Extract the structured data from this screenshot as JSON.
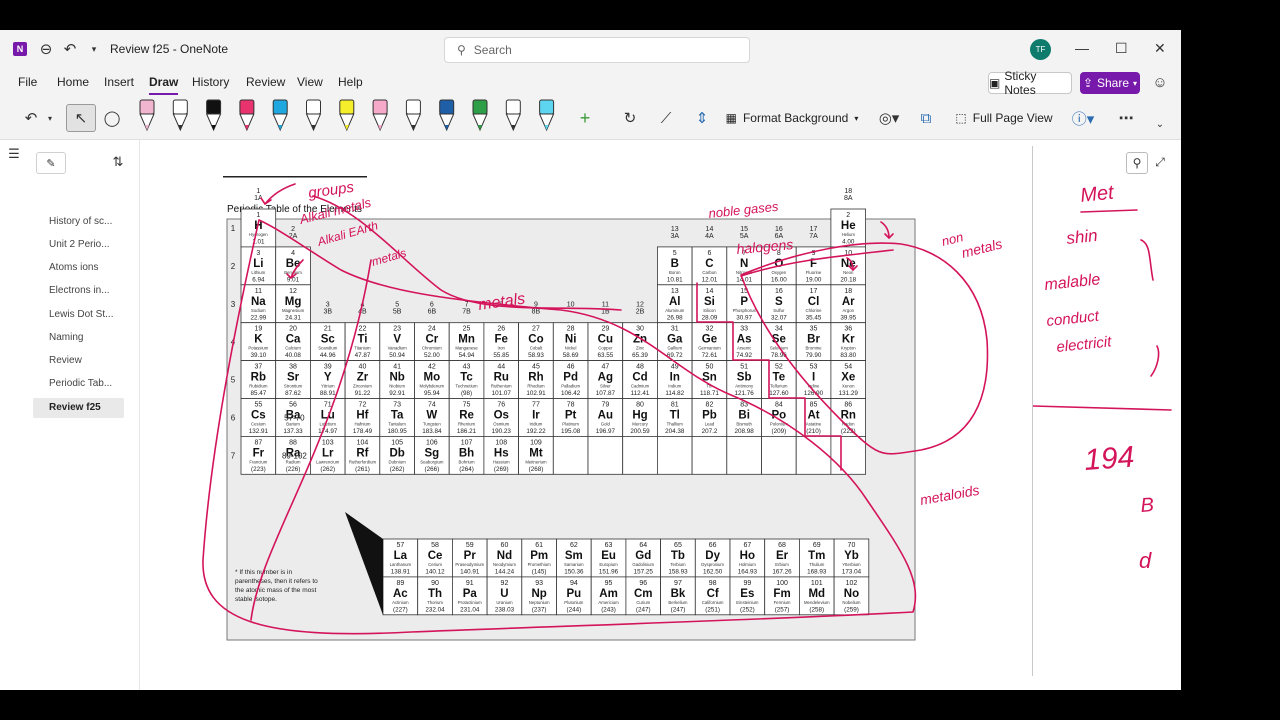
{
  "window": {
    "title": "Review f25 - OneNote",
    "app_icon_letter": "N"
  },
  "titlebar": {
    "search_placeholder": "Search",
    "avatar_initials": "TF"
  },
  "menu": [
    "File",
    "Home",
    "Insert",
    "Draw",
    "History",
    "Review",
    "View",
    "Help"
  ],
  "menu_active": "Draw",
  "toolbar": {
    "sticky_notes": "Sticky Notes",
    "share": "Share",
    "format_background": "Format Background",
    "full_page_view": "Full Page View"
  },
  "sidebar": {
    "pages": [
      "History of sc...",
      "Unit 2 Perio...",
      "Atoms ions",
      "Electrons in...",
      "Lewis Dot St...",
      "Naming",
      "Review",
      "Periodic Tab...",
      "Review f25"
    ],
    "selected": "Review f25"
  },
  "colors": {
    "accent": "#7719aa",
    "ink": "#d4145a",
    "titlebar": "#f3f3f3"
  },
  "periodic_table": {
    "title": "Periodic Table of the Elements",
    "footnote": "* If this number is in parentheses, then it refers to the atomic mass of the most stable isotope.",
    "lanthanide_range": "57-70",
    "actinide_range": "89-102",
    "group_labels": [
      {
        "g": 1,
        "n": "1",
        "s": "1A"
      },
      {
        "g": 2,
        "n": "2",
        "s": "2A"
      },
      {
        "g": 3,
        "n": "3",
        "s": "3B"
      },
      {
        "g": 4,
        "n": "4",
        "s": "4B"
      },
      {
        "g": 5,
        "n": "5",
        "s": "5B"
      },
      {
        "g": 6,
        "n": "6",
        "s": "6B"
      },
      {
        "g": 7,
        "n": "7",
        "s": "7B"
      },
      {
        "g": 8,
        "n": "8",
        "s": ""
      },
      {
        "g": 9,
        "n": "9",
        "s": "8B"
      },
      {
        "g": 10,
        "n": "10",
        "s": ""
      },
      {
        "g": 11,
        "n": "11",
        "s": "1B"
      },
      {
        "g": 12,
        "n": "12",
        "s": "2B"
      },
      {
        "g": 13,
        "n": "13",
        "s": "3A"
      },
      {
        "g": 14,
        "n": "14",
        "s": "4A"
      },
      {
        "g": 15,
        "n": "15",
        "s": "5A"
      },
      {
        "g": 16,
        "n": "16",
        "s": "6A"
      },
      {
        "g": 17,
        "n": "17",
        "s": "7A"
      },
      {
        "g": 18,
        "n": "18",
        "s": "8A"
      }
    ],
    "elements": [
      {
        "n": 1,
        "s": "H",
        "name": "Hydrogen",
        "m": "1.01",
        "p": 1,
        "g": 1
      },
      {
        "n": 2,
        "s": "He",
        "name": "Helium",
        "m": "4.00",
        "p": 1,
        "g": 18
      },
      {
        "n": 3,
        "s": "Li",
        "name": "Lithium",
        "m": "6.94",
        "p": 2,
        "g": 1
      },
      {
        "n": 4,
        "s": "Be",
        "name": "Beryllium",
        "m": "9.01",
        "p": 2,
        "g": 2
      },
      {
        "n": 5,
        "s": "B",
        "name": "Boron",
        "m": "10.81",
        "p": 2,
        "g": 13
      },
      {
        "n": 6,
        "s": "C",
        "name": "Carbon",
        "m": "12.01",
        "p": 2,
        "g": 14
      },
      {
        "n": 7,
        "s": "N",
        "name": "Nitrogen",
        "m": "14.01",
        "p": 2,
        "g": 15
      },
      {
        "n": 8,
        "s": "O",
        "name": "Oxygen",
        "m": "16.00",
        "p": 2,
        "g": 16
      },
      {
        "n": 9,
        "s": "F",
        "name": "Fluorine",
        "m": "19.00",
        "p": 2,
        "g": 17
      },
      {
        "n": 10,
        "s": "Ne",
        "name": "Neon",
        "m": "20.18",
        "p": 2,
        "g": 18
      },
      {
        "n": 11,
        "s": "Na",
        "name": "Sodium",
        "m": "22.99",
        "p": 3,
        "g": 1
      },
      {
        "n": 12,
        "s": "Mg",
        "name": "Magnesium",
        "m": "24.31",
        "p": 3,
        "g": 2
      },
      {
        "n": 13,
        "s": "Al",
        "name": "Aluminum",
        "m": "26.98",
        "p": 3,
        "g": 13
      },
      {
        "n": 14,
        "s": "Si",
        "name": "Silicon",
        "m": "28.09",
        "p": 3,
        "g": 14
      },
      {
        "n": 15,
        "s": "P",
        "name": "Phosphorus",
        "m": "30.97",
        "p": 3,
        "g": 15
      },
      {
        "n": 16,
        "s": "S",
        "name": "Sulfur",
        "m": "32.07",
        "p": 3,
        "g": 16
      },
      {
        "n": 17,
        "s": "Cl",
        "name": "Chlorine",
        "m": "35.45",
        "p": 3,
        "g": 17
      },
      {
        "n": 18,
        "s": "Ar",
        "name": "Argon",
        "m": "39.95",
        "p": 3,
        "g": 18
      },
      {
        "n": 19,
        "s": "K",
        "name": "Potassium",
        "m": "39.10",
        "p": 4,
        "g": 1
      },
      {
        "n": 20,
        "s": "Ca",
        "name": "Calcium",
        "m": "40.08",
        "p": 4,
        "g": 2
      },
      {
        "n": 21,
        "s": "Sc",
        "name": "Scandium",
        "m": "44.96",
        "p": 4,
        "g": 3
      },
      {
        "n": 22,
        "s": "Ti",
        "name": "Titanium",
        "m": "47.87",
        "p": 4,
        "g": 4
      },
      {
        "n": 23,
        "s": "V",
        "name": "Vanadium",
        "m": "50.94",
        "p": 4,
        "g": 5
      },
      {
        "n": 24,
        "s": "Cr",
        "name": "Chromium",
        "m": "52.00",
        "p": 4,
        "g": 6
      },
      {
        "n": 25,
        "s": "Mn",
        "name": "Manganese",
        "m": "54.94",
        "p": 4,
        "g": 7
      },
      {
        "n": 26,
        "s": "Fe",
        "name": "Iron",
        "m": "55.85",
        "p": 4,
        "g": 8
      },
      {
        "n": 27,
        "s": "Co",
        "name": "Cobalt",
        "m": "58.93",
        "p": 4,
        "g": 9
      },
      {
        "n": 28,
        "s": "Ni",
        "name": "Nickel",
        "m": "58.69",
        "p": 4,
        "g": 10
      },
      {
        "n": 29,
        "s": "Cu",
        "name": "Copper",
        "m": "63.55",
        "p": 4,
        "g": 11
      },
      {
        "n": 30,
        "s": "Zn",
        "name": "Zinc",
        "m": "65.39",
        "p": 4,
        "g": 12
      },
      {
        "n": 31,
        "s": "Ga",
        "name": "Gallium",
        "m": "69.72",
        "p": 4,
        "g": 13
      },
      {
        "n": 32,
        "s": "Ge",
        "name": "Germanium",
        "m": "72.61",
        "p": 4,
        "g": 14
      },
      {
        "n": 33,
        "s": "As",
        "name": "Arsenic",
        "m": "74.92",
        "p": 4,
        "g": 15
      },
      {
        "n": 34,
        "s": "Se",
        "name": "Selenium",
        "m": "78.96",
        "p": 4,
        "g": 16
      },
      {
        "n": 35,
        "s": "Br",
        "name": "Bromine",
        "m": "79.90",
        "p": 4,
        "g": 17
      },
      {
        "n": 36,
        "s": "Kr",
        "name": "Krypton",
        "m": "83.80",
        "p": 4,
        "g": 18
      },
      {
        "n": 37,
        "s": "Rb",
        "name": "Rubidium",
        "m": "85.47",
        "p": 5,
        "g": 1
      },
      {
        "n": 38,
        "s": "Sr",
        "name": "Strontium",
        "m": "87.62",
        "p": 5,
        "g": 2
      },
      {
        "n": 39,
        "s": "Y",
        "name": "Yttrium",
        "m": "88.91",
        "p": 5,
        "g": 3
      },
      {
        "n": 40,
        "s": "Zr",
        "name": "Zirconium",
        "m": "91.22",
        "p": 5,
        "g": 4
      },
      {
        "n": 41,
        "s": "Nb",
        "name": "Niobium",
        "m": "92.91",
        "p": 5,
        "g": 5
      },
      {
        "n": 42,
        "s": "Mo",
        "name": "Molybdenum",
        "m": "95.94",
        "p": 5,
        "g": 6
      },
      {
        "n": 43,
        "s": "Tc",
        "name": "Technetium",
        "m": "(98)",
        "p": 5,
        "g": 7
      },
      {
        "n": 44,
        "s": "Ru",
        "name": "Ruthenium",
        "m": "101.07",
        "p": 5,
        "g": 8
      },
      {
        "n": 45,
        "s": "Rh",
        "name": "Rhodium",
        "m": "102.91",
        "p": 5,
        "g": 9
      },
      {
        "n": 46,
        "s": "Pd",
        "name": "Palladium",
        "m": "106.42",
        "p": 5,
        "g": 10
      },
      {
        "n": 47,
        "s": "Ag",
        "name": "Silver",
        "m": "107.87",
        "p": 5,
        "g": 11
      },
      {
        "n": 48,
        "s": "Cd",
        "name": "Cadmium",
        "m": "112.41",
        "p": 5,
        "g": 12
      },
      {
        "n": 49,
        "s": "In",
        "name": "Indium",
        "m": "114.82",
        "p": 5,
        "g": 13
      },
      {
        "n": 50,
        "s": "Sn",
        "name": "Tin",
        "m": "118.71",
        "p": 5,
        "g": 14
      },
      {
        "n": 51,
        "s": "Sb",
        "name": "Antimony",
        "m": "121.76",
        "p": 5,
        "g": 15
      },
      {
        "n": 52,
        "s": "Te",
        "name": "Tellurium",
        "m": "127.60",
        "p": 5,
        "g": 16
      },
      {
        "n": 53,
        "s": "I",
        "name": "Iodine",
        "m": "126.90",
        "p": 5,
        "g": 17
      },
      {
        "n": 54,
        "s": "Xe",
        "name": "Xenon",
        "m": "131.29",
        "p": 5,
        "g": 18
      },
      {
        "n": 55,
        "s": "Cs",
        "name": "Cesium",
        "m": "132.91",
        "p": 6,
        "g": 1
      },
      {
        "n": 56,
        "s": "Ba",
        "name": "Barium",
        "m": "137.33",
        "p": 6,
        "g": 2
      },
      {
        "n": 71,
        "s": "Lu",
        "name": "Lutetium",
        "m": "174.97",
        "p": 6,
        "g": 3
      },
      {
        "n": 72,
        "s": "Hf",
        "name": "Hafnium",
        "m": "178.49",
        "p": 6,
        "g": 4
      },
      {
        "n": 73,
        "s": "Ta",
        "name": "Tantalum",
        "m": "180.95",
        "p": 6,
        "g": 5
      },
      {
        "n": 74,
        "s": "W",
        "name": "Tungsten",
        "m": "183.84",
        "p": 6,
        "g": 6
      },
      {
        "n": 75,
        "s": "Re",
        "name": "Rhenium",
        "m": "186.21",
        "p": 6,
        "g": 7
      },
      {
        "n": 76,
        "s": "Os",
        "name": "Osmium",
        "m": "190.23",
        "p": 6,
        "g": 8
      },
      {
        "n": 77,
        "s": "Ir",
        "name": "Iridium",
        "m": "192.22",
        "p": 6,
        "g": 9
      },
      {
        "n": 78,
        "s": "Pt",
        "name": "Platinum",
        "m": "195.08",
        "p": 6,
        "g": 10
      },
      {
        "n": 79,
        "s": "Au",
        "name": "Gold",
        "m": "196.97",
        "p": 6,
        "g": 11
      },
      {
        "n": 80,
        "s": "Hg",
        "name": "Mercury",
        "m": "200.59",
        "p": 6,
        "g": 12
      },
      {
        "n": 81,
        "s": "Tl",
        "name": "Thallium",
        "m": "204.38",
        "p": 6,
        "g": 13
      },
      {
        "n": 82,
        "s": "Pb",
        "name": "Lead",
        "m": "207.2",
        "p": 6,
        "g": 14
      },
      {
        "n": 83,
        "s": "Bi",
        "name": "Bismuth",
        "m": "208.98",
        "p": 6,
        "g": 15
      },
      {
        "n": 84,
        "s": "Po",
        "name": "Polonium",
        "m": "(209)",
        "p": 6,
        "g": 16
      },
      {
        "n": 85,
        "s": "At",
        "name": "Astatine",
        "m": "(210)",
        "p": 6,
        "g": 17
      },
      {
        "n": 86,
        "s": "Rn",
        "name": "Radon",
        "m": "(222)",
        "p": 6,
        "g": 18
      },
      {
        "n": 87,
        "s": "Fr",
        "name": "Francium",
        "m": "(223)",
        "p": 7,
        "g": 1
      },
      {
        "n": 88,
        "s": "Ra",
        "name": "Radium",
        "m": "(226)",
        "p": 7,
        "g": 2
      },
      {
        "n": 103,
        "s": "Lr",
        "name": "Lawrencium",
        "m": "(262)",
        "p": 7,
        "g": 3
      },
      {
        "n": 104,
        "s": "Rf",
        "name": "Rutherfordium",
        "m": "(261)",
        "p": 7,
        "g": 4
      },
      {
        "n": 105,
        "s": "Db",
        "name": "Dubnium",
        "m": "(262)",
        "p": 7,
        "g": 5
      },
      {
        "n": 106,
        "s": "Sg",
        "name": "Seaborgium",
        "m": "(266)",
        "p": 7,
        "g": 6
      },
      {
        "n": 107,
        "s": "Bh",
        "name": "Bohrium",
        "m": "(264)",
        "p": 7,
        "g": 7
      },
      {
        "n": 108,
        "s": "Hs",
        "name": "Hassium",
        "m": "(269)",
        "p": 7,
        "g": 8
      },
      {
        "n": 109,
        "s": "Mt",
        "name": "Meitnerium",
        "m": "(268)",
        "p": 7,
        "g": 9
      }
    ],
    "lanthanides": [
      {
        "n": 57,
        "s": "La",
        "name": "Lanthanum",
        "m": "138.91"
      },
      {
        "n": 58,
        "s": "Ce",
        "name": "Cerium",
        "m": "140.12"
      },
      {
        "n": 59,
        "s": "Pr",
        "name": "Praseodymium",
        "m": "140.91"
      },
      {
        "n": 60,
        "s": "Nd",
        "name": "Neodymium",
        "m": "144.24"
      },
      {
        "n": 61,
        "s": "Pm",
        "name": "Promethium",
        "m": "(145)"
      },
      {
        "n": 62,
        "s": "Sm",
        "name": "Samarium",
        "m": "150.36"
      },
      {
        "n": 63,
        "s": "Eu",
        "name": "Europium",
        "m": "151.96"
      },
      {
        "n": 64,
        "s": "Gd",
        "name": "Gadolinium",
        "m": "157.25"
      },
      {
        "n": 65,
        "s": "Tb",
        "name": "Terbium",
        "m": "158.93"
      },
      {
        "n": 66,
        "s": "Dy",
        "name": "Dysprosium",
        "m": "162.50"
      },
      {
        "n": 67,
        "s": "Ho",
        "name": "Holmium",
        "m": "164.93"
      },
      {
        "n": 68,
        "s": "Er",
        "name": "Erbium",
        "m": "167.26"
      },
      {
        "n": 69,
        "s": "Tm",
        "name": "Thulium",
        "m": "168.93"
      },
      {
        "n": 70,
        "s": "Yb",
        "name": "Ytterbium",
        "m": "173.04"
      }
    ],
    "actinides": [
      {
        "n": 89,
        "s": "Ac",
        "name": "Actinium",
        "m": "(227)"
      },
      {
        "n": 90,
        "s": "Th",
        "name": "Thorium",
        "m": "232.04"
      },
      {
        "n": 91,
        "s": "Pa",
        "name": "Protactinium",
        "m": "231.04"
      },
      {
        "n": 92,
        "s": "U",
        "name": "Uranium",
        "m": "238.03"
      },
      {
        "n": 93,
        "s": "Np",
        "name": "Neptunium",
        "m": "(237)"
      },
      {
        "n": 94,
        "s": "Pu",
        "name": "Plutonium",
        "m": "(244)"
      },
      {
        "n": 95,
        "s": "Am",
        "name": "Americium",
        "m": "(243)"
      },
      {
        "n": 96,
        "s": "Cm",
        "name": "Curium",
        "m": "(247)"
      },
      {
        "n": 97,
        "s": "Bk",
        "name": "Berkelium",
        "m": "(247)"
      },
      {
        "n": 98,
        "s": "Cf",
        "name": "Californium",
        "m": "(251)"
      },
      {
        "n": 99,
        "s": "Es",
        "name": "Einsteinium",
        "m": "(252)"
      },
      {
        "n": 100,
        "s": "Fm",
        "name": "Fermium",
        "m": "(257)"
      },
      {
        "n": 101,
        "s": "Md",
        "name": "Mendelevium",
        "m": "(258)"
      },
      {
        "n": 102,
        "s": "No",
        "name": "Nobelium",
        "m": "(259)"
      }
    ]
  },
  "annotations": {
    "groups": "groups",
    "alkali_metals": "Alkali metals",
    "alkali_earth_metals": "Alkali EArth metals",
    "metals": "metals",
    "noble_gases": "noble gases",
    "halogens": "halogens",
    "non_metals": "non metals",
    "metalloids": "metaloids",
    "right_notes": [
      "Met",
      "shin",
      "malable",
      "conduct",
      "electricit",
      "194",
      "B",
      "d"
    ]
  }
}
